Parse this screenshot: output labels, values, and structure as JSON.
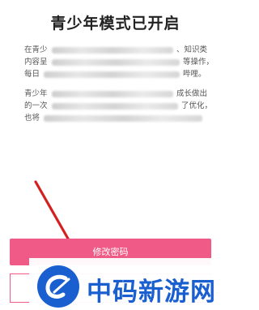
{
  "page": {
    "title": "青少年模式已开启"
  },
  "paragraph1": {
    "line1_start": "在青少",
    "line1_end": "、知识类",
    "line2_start": "内容呈",
    "line2_end": "等操作，",
    "line3_start": "每日",
    "line3_end": "哔哩。"
  },
  "paragraph2": {
    "line1_start": "青少年",
    "line1_end": "成长做出",
    "line2_start": "的一次",
    "line2_end": "了优化，",
    "line3_start": "也将"
  },
  "buttons": {
    "change_password": "修改密码"
  },
  "watermark": {
    "text": "中码新游网"
  },
  "colors": {
    "accent": "#f05a86",
    "arrow": "#d32020",
    "watermark_blue": "#1a5fd0"
  }
}
